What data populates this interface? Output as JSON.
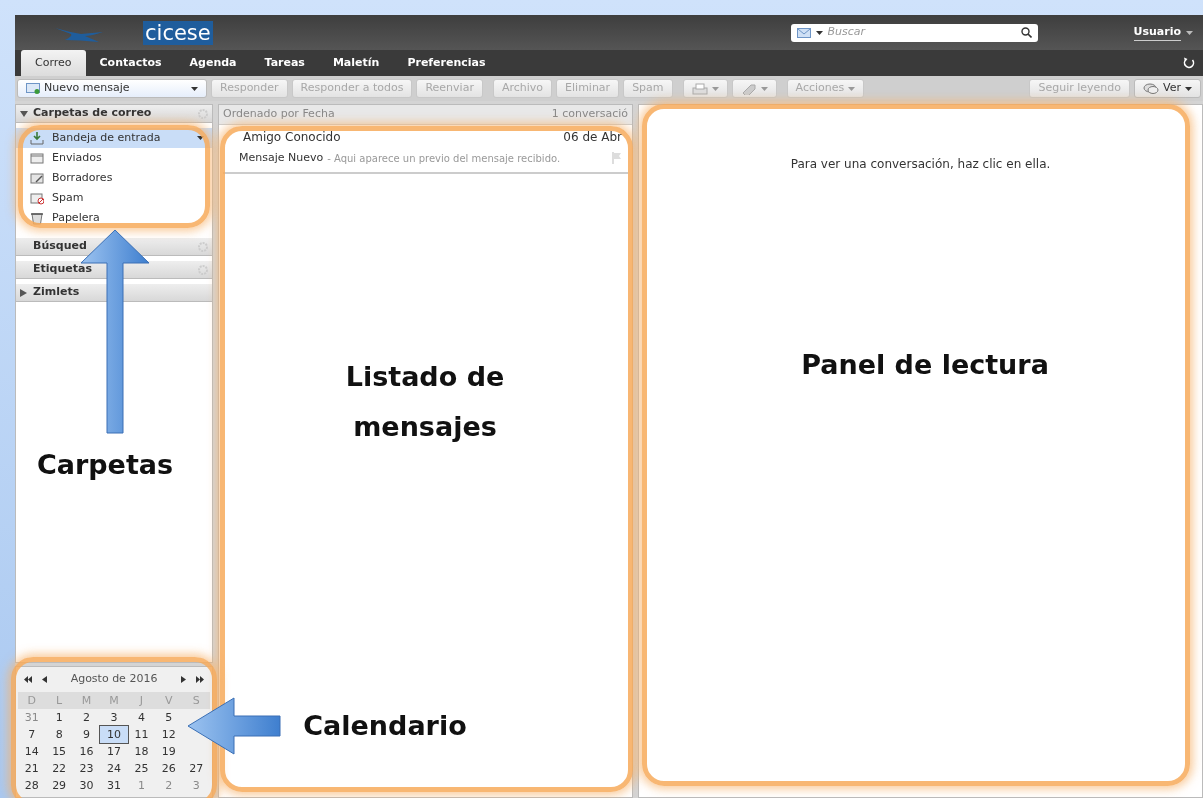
{
  "header": {
    "logo": "cicese",
    "search": {
      "placeholder": "Buscar"
    },
    "user": "Usuario"
  },
  "tabs": [
    {
      "label": "Correo",
      "selected": true
    },
    {
      "label": "Contactos",
      "selected": false
    },
    {
      "label": "Agenda",
      "selected": false
    },
    {
      "label": "Tareas",
      "selected": false
    },
    {
      "label": "Maletín",
      "selected": false
    },
    {
      "label": "Preferencias",
      "selected": false
    }
  ],
  "toolbar": {
    "new_button": "Nuevo mensaje",
    "buttons": [
      {
        "label": "Responder",
        "disabled": true
      },
      {
        "label": "Responder a todos",
        "disabled": true
      },
      {
        "label": "Reenviar",
        "disabled": true
      },
      {
        "label": "Archivo",
        "disabled": true
      },
      {
        "label": "Eliminar",
        "disabled": true
      },
      {
        "label": "Spam",
        "disabled": true
      }
    ],
    "actions": "Acciones",
    "right_buttons": [
      {
        "label": "Seguir leyendo",
        "disabled": true
      },
      {
        "label": "Ver",
        "disabled": false
      }
    ]
  },
  "sidebar": {
    "sections": [
      {
        "title": "Carpetas de correo",
        "expanded": true,
        "items": [
          {
            "label": "Bandeja de entrada",
            "kind": "inbox",
            "selected": true
          },
          {
            "label": "Enviados",
            "kind": "sent",
            "selected": false
          },
          {
            "label": "Borradores",
            "kind": "drafts",
            "selected": false
          },
          {
            "label": "Spam",
            "kind": "spam",
            "selected": false
          },
          {
            "label": "Papelera",
            "kind": "trash",
            "selected": false
          }
        ]
      },
      {
        "title": "Búsqued",
        "expanded": false,
        "kind": "plain"
      },
      {
        "title": "Etiquetas",
        "expanded": false,
        "kind": "plain"
      },
      {
        "title": "Zimlets",
        "expanded": false,
        "kind": "collapsible"
      }
    ]
  },
  "message_list": {
    "sort": "Ordenado por Fecha",
    "count": "1 conversació",
    "messages": [
      {
        "sender": "Amigo Conocido",
        "date": "06 de Abr",
        "subject": "Mensaje Nuevo",
        "preview": "- Aqui aparece un previo del  mensaje recibido."
      }
    ]
  },
  "reading_pane": {
    "hint": "Para ver una conversación, haz clic en ella."
  },
  "calendar": {
    "title": "Agosto de 2016",
    "weekdays": [
      "D",
      "L",
      "M",
      "M",
      "J",
      "V",
      "S"
    ],
    "weeks": [
      [
        {
          "day": "31",
          "other_month": true,
          "selected": false
        },
        {
          "day": "1",
          "other_month": false,
          "selected": false
        },
        {
          "day": "2",
          "other_month": false,
          "selected": false
        },
        {
          "day": "3",
          "other_month": false,
          "selected": false
        },
        {
          "day": "4",
          "other_month": false,
          "selected": false
        },
        {
          "day": "5",
          "other_month": false,
          "selected": false
        }
      ],
      [
        {
          "day": "7",
          "other_month": false,
          "selected": false
        },
        {
          "day": "8",
          "other_month": false,
          "selected": false
        },
        {
          "day": "9",
          "other_month": false,
          "selected": false
        },
        {
          "day": "10",
          "other_month": false,
          "selected": true
        },
        {
          "day": "11",
          "other_month": false,
          "selected": false
        },
        {
          "day": "12",
          "other_month": false,
          "selected": false
        }
      ],
      [
        {
          "day": "14",
          "other_month": false,
          "selected": false
        },
        {
          "day": "15",
          "other_month": false,
          "selected": false
        },
        {
          "day": "16",
          "other_month": false,
          "selected": false
        },
        {
          "day": "17",
          "other_month": false,
          "selected": false
        },
        {
          "day": "18",
          "other_month": false,
          "selected": false
        },
        {
          "day": "19",
          "other_month": false,
          "selected": false
        }
      ],
      [
        {
          "day": "21",
          "other_month": false,
          "selected": false
        },
        {
          "day": "22",
          "other_month": false,
          "selected": false
        },
        {
          "day": "23",
          "other_month": false,
          "selected": false
        },
        {
          "day": "24",
          "other_month": false,
          "selected": false
        },
        {
          "day": "25",
          "other_month": false,
          "selected": false
        },
        {
          "day": "26",
          "other_month": false,
          "selected": false
        },
        {
          "day": "27",
          "other_month": false,
          "selected": false
        }
      ],
      [
        {
          "day": "28",
          "other_month": false,
          "selected": false
        },
        {
          "day": "29",
          "other_month": false,
          "selected": false
        },
        {
          "day": "30",
          "other_month": false,
          "selected": false
        },
        {
          "day": "31",
          "other_month": false,
          "selected": false
        },
        {
          "day": "1",
          "other_month": true,
          "selected": false
        },
        {
          "day": "2",
          "other_month": true,
          "selected": false
        },
        {
          "day": "3",
          "other_month": true,
          "selected": false
        }
      ]
    ]
  },
  "annotations": [
    {
      "kind": "carpetas",
      "text": "Carpetas"
    },
    {
      "kind": "listado",
      "text": "Listado de mensajes"
    },
    {
      "kind": "panel",
      "text": "Panel de lectura"
    },
    {
      "kind": "calendario",
      "text": "Calendario"
    }
  ]
}
